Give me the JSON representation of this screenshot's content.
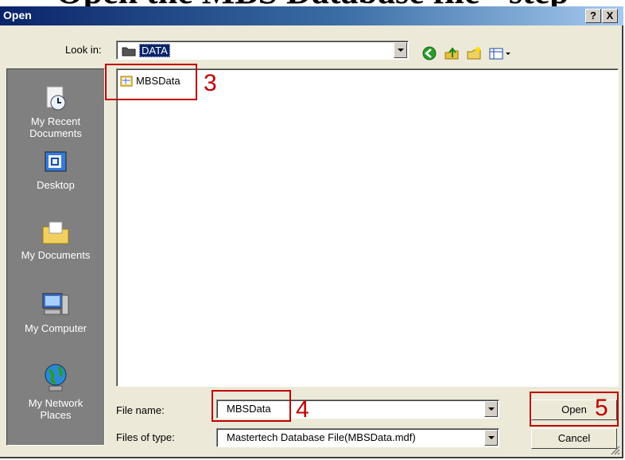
{
  "clipped_heading": "Open the MBS Database file - step",
  "dialog": {
    "title": "Open",
    "help_btn": "?",
    "close_btn": "X"
  },
  "look_in": {
    "label": "Look in:",
    "value": "DATA"
  },
  "places": [
    {
      "label": "My Recent\nDocuments",
      "icon": "recent-documents-icon"
    },
    {
      "label": "Desktop",
      "icon": "desktop-icon"
    },
    {
      "label": "My Documents",
      "icon": "my-documents-icon"
    },
    {
      "label": "My Computer",
      "icon": "my-computer-icon"
    },
    {
      "label": "My Network\nPlaces",
      "icon": "network-places-icon"
    }
  ],
  "files": [
    {
      "name": "MBSData",
      "icon": "database-file-icon"
    }
  ],
  "file_name": {
    "label": "File name:",
    "value": "MBSData"
  },
  "file_type": {
    "label": "Files of type:",
    "value": "Mastertech Database File(MBSData.mdf)"
  },
  "buttons": {
    "open": "Open",
    "cancel": "Cancel"
  },
  "annotations": [
    "3",
    "4",
    "5"
  ],
  "colors": {
    "annotation": "#c00000",
    "titlebar": "#0a246a",
    "places_bg": "#808080"
  }
}
